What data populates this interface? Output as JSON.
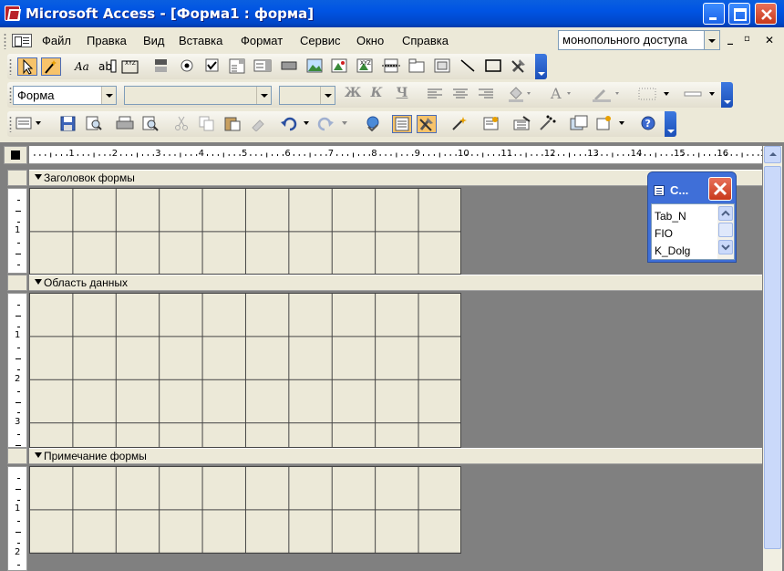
{
  "window": {
    "title": "Microsoft Access - [Форма1 : форма]"
  },
  "menubar": {
    "items": [
      "Файл",
      "Правка",
      "Вид",
      "Вставка",
      "Формат",
      "Сервис",
      "Окно",
      "Справка"
    ],
    "help_box_value": "монопольного доступа"
  },
  "toolbox": {
    "icons": [
      "select-objects-icon",
      "control-wizards-icon",
      "label-icon",
      "textbox-icon",
      "option-group-icon",
      "toggle-button-icon",
      "option-button-icon",
      "checkbox-icon",
      "combobox-icon",
      "listbox-icon",
      "command-button-icon",
      "image-icon",
      "unbound-object-icon",
      "bound-object-icon",
      "page-break-icon",
      "tab-control-icon",
      "subform-icon",
      "line-icon",
      "rectangle-icon",
      "more-controls-icon"
    ]
  },
  "formatting": {
    "object_selector": "Форма",
    "font_name": "",
    "font_size": "",
    "bold_label": "Ж",
    "italic_label": "К",
    "underline_label": "Ч",
    "font_color_label": "A"
  },
  "form_design_toolbar": {
    "icons": [
      "view-icon",
      "save-icon",
      "search-icon",
      "print-icon",
      "print-preview-icon",
      "cut-icon",
      "copy-icon",
      "paste-icon",
      "format-painter-icon",
      "undo-icon",
      "redo-icon",
      "hyperlink-icon",
      "field-list-icon",
      "toolbox-icon",
      "autoformat-icon",
      "code-icon",
      "properties-icon",
      "build-icon",
      "database-window-icon",
      "new-object-icon",
      "help-icon"
    ]
  },
  "ruler": {
    "horizontal_marks": [
      "1",
      "2",
      "3",
      "4",
      "5",
      "6",
      "7",
      "8",
      "9",
      "10",
      "11",
      "12",
      "13",
      "14",
      "15",
      "16",
      "1"
    ],
    "header_marks": [
      "1"
    ],
    "detail_marks": [
      "1",
      "2",
      "3"
    ],
    "footer_marks": [
      "1",
      "2"
    ]
  },
  "sections": {
    "header": "Заголовок формы",
    "detail": "Область данных",
    "footer": "Примечание формы"
  },
  "field_list": {
    "title": "С...",
    "fields": [
      "Tab_N",
      "FIO",
      "K_Dolg"
    ]
  }
}
